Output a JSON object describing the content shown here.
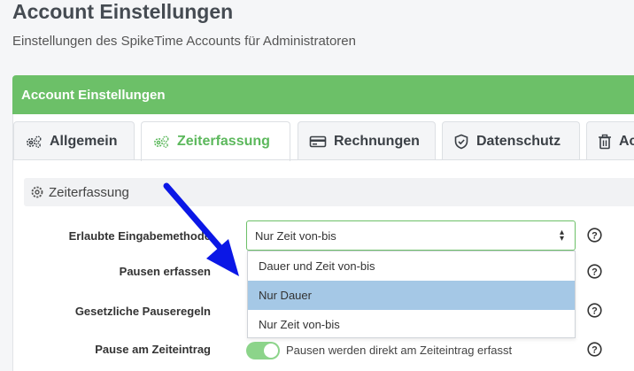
{
  "page": {
    "title": "Account Einstellungen",
    "subtitle": "Einstellungen des SpikeTime Accounts für Administratoren"
  },
  "card": {
    "header": "Account Einstellungen"
  },
  "tabs": [
    {
      "label": "Allgemein",
      "icon": "gears-icon",
      "active": false
    },
    {
      "label": "Zeiterfassung",
      "icon": "gears-icon",
      "active": true
    },
    {
      "label": "Rechnungen",
      "icon": "credit-card-icon",
      "active": false
    },
    {
      "label": "Datenschutz",
      "icon": "shield-icon",
      "active": false
    },
    {
      "label": "Ac",
      "icon": "trash-icon",
      "active": false
    }
  ],
  "section": {
    "title": "Zeiterfassung",
    "icon": "gear-icon"
  },
  "form": {
    "eingabemethode_label": "Erlaubte Eingabemethode",
    "pausen_label": "Pausen erfassen",
    "pauseregeln_label": "Gesetzliche Pauseregeln",
    "pause_eintrag_label": "Pause am Zeiteintrag",
    "select_value": "Nur Zeit von-bis",
    "options": [
      "Dauer und Zeit von-bis",
      "Nur Dauer",
      "Nur Zeit von-bis"
    ],
    "highlighted_option": "Nur Dauer",
    "toggle_text": "Pausen werden direkt am Zeiteintrag erfasst",
    "toggle_on": true
  },
  "colors": {
    "accent": "#6cc068",
    "annotation_arrow": "#0b17e6",
    "option_highlight": "#a5c8e6"
  }
}
